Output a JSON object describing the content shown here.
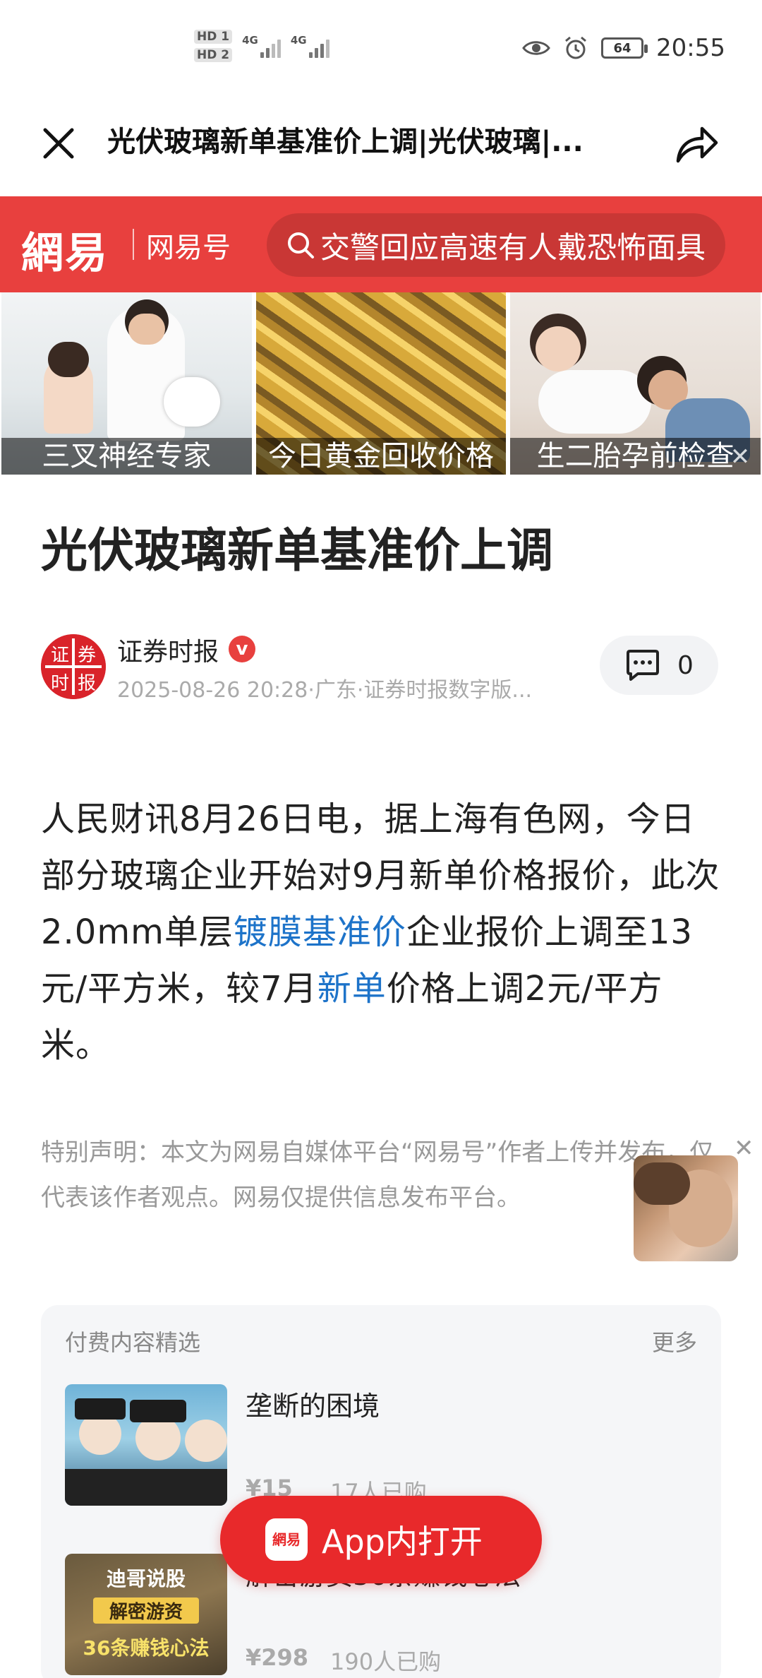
{
  "status_bar": {
    "hd1": "HD 1",
    "hd2": "HD 2",
    "network1": "4G",
    "network2": "4G",
    "battery": "64",
    "time": "20:55"
  },
  "title_bar": {
    "title": "光伏玻璃新单基准价上调|光伏玻璃|..."
  },
  "header": {
    "logo": "網易",
    "channel": "网易号",
    "search_text": "交警回应高速有人戴恐怖面具"
  },
  "ads": [
    {
      "caption": "三叉神经专家"
    },
    {
      "caption": "今日黄金回收价格"
    },
    {
      "caption": "生二胎孕前检查"
    }
  ],
  "article": {
    "title": "光伏玻璃新单基准价上调",
    "author": "证券时报",
    "verified_mark": "v",
    "meta": "2025-08-26 20:28·广东·证券时报数字版...",
    "comment_count": "0",
    "body_1": "人民财讯8月26日电，据上海有色网，今日部分玻璃企业开始对9月新单价格报价，此次2.0mm单层",
    "link_1": "镀膜基准价",
    "body_2": "企业报价上调至13元/平方米，较7月",
    "link_2": "新单",
    "body_3": "价格上调2元/平方米。",
    "disclaimer": "特别声明：本文为网易自媒体平台“网易号”作者上传并发布，仅代表该作者观点。网易仅提供信息发布平台。"
  },
  "paid": {
    "header": "付费内容精选",
    "more": "更多",
    "items": [
      {
        "title": "垄断的困境",
        "price": "¥15",
        "buyers": "17人已购"
      },
      {
        "title": "解密游资36条赚钱心法",
        "price": "¥298",
        "buyers": "190人已购",
        "thumb_line1": "迪哥说股",
        "thumb_line2": "解密游资",
        "thumb_line3": "36条赚钱心法"
      }
    ]
  },
  "open_app": {
    "icon_text": "網易",
    "label": "App内打开"
  }
}
